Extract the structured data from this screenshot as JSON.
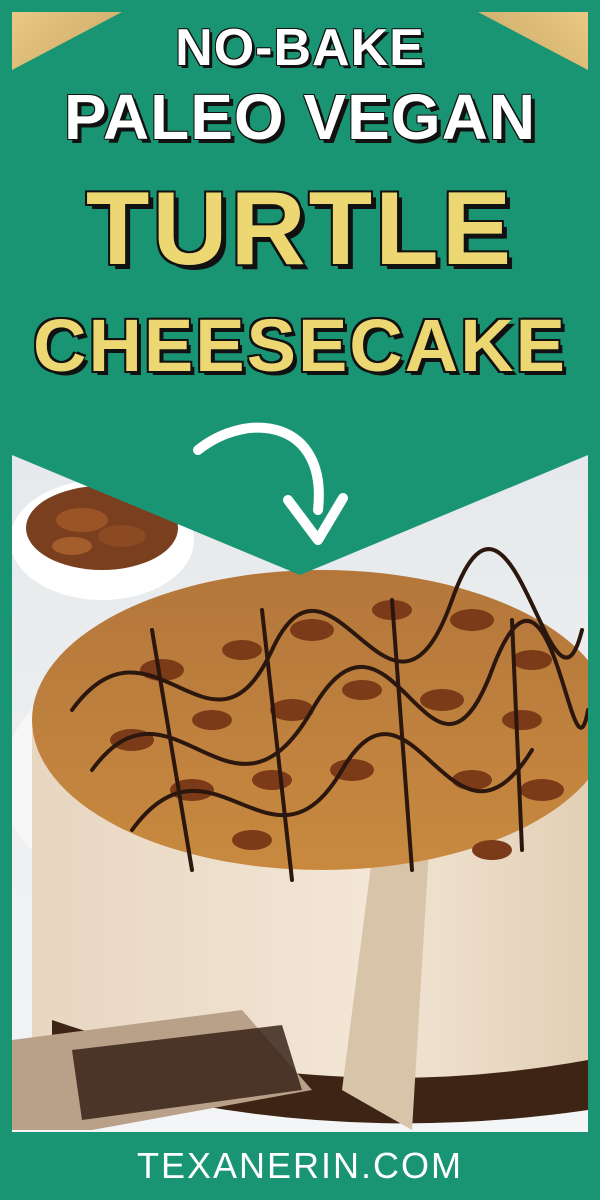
{
  "headline": {
    "line1": "NO-BAKE",
    "line2": "PALEO VEGAN",
    "line3": "TURTLE",
    "line4": "CHEESECAKE"
  },
  "footer": {
    "site": "TEXANERIN.COM"
  },
  "colors": {
    "background": "#1a9573",
    "accent_yellow": "#ecd772",
    "text_white": "#ffffff",
    "outline": "#111111"
  },
  "icons": {
    "arrow": "curved-arrow-down-icon"
  }
}
